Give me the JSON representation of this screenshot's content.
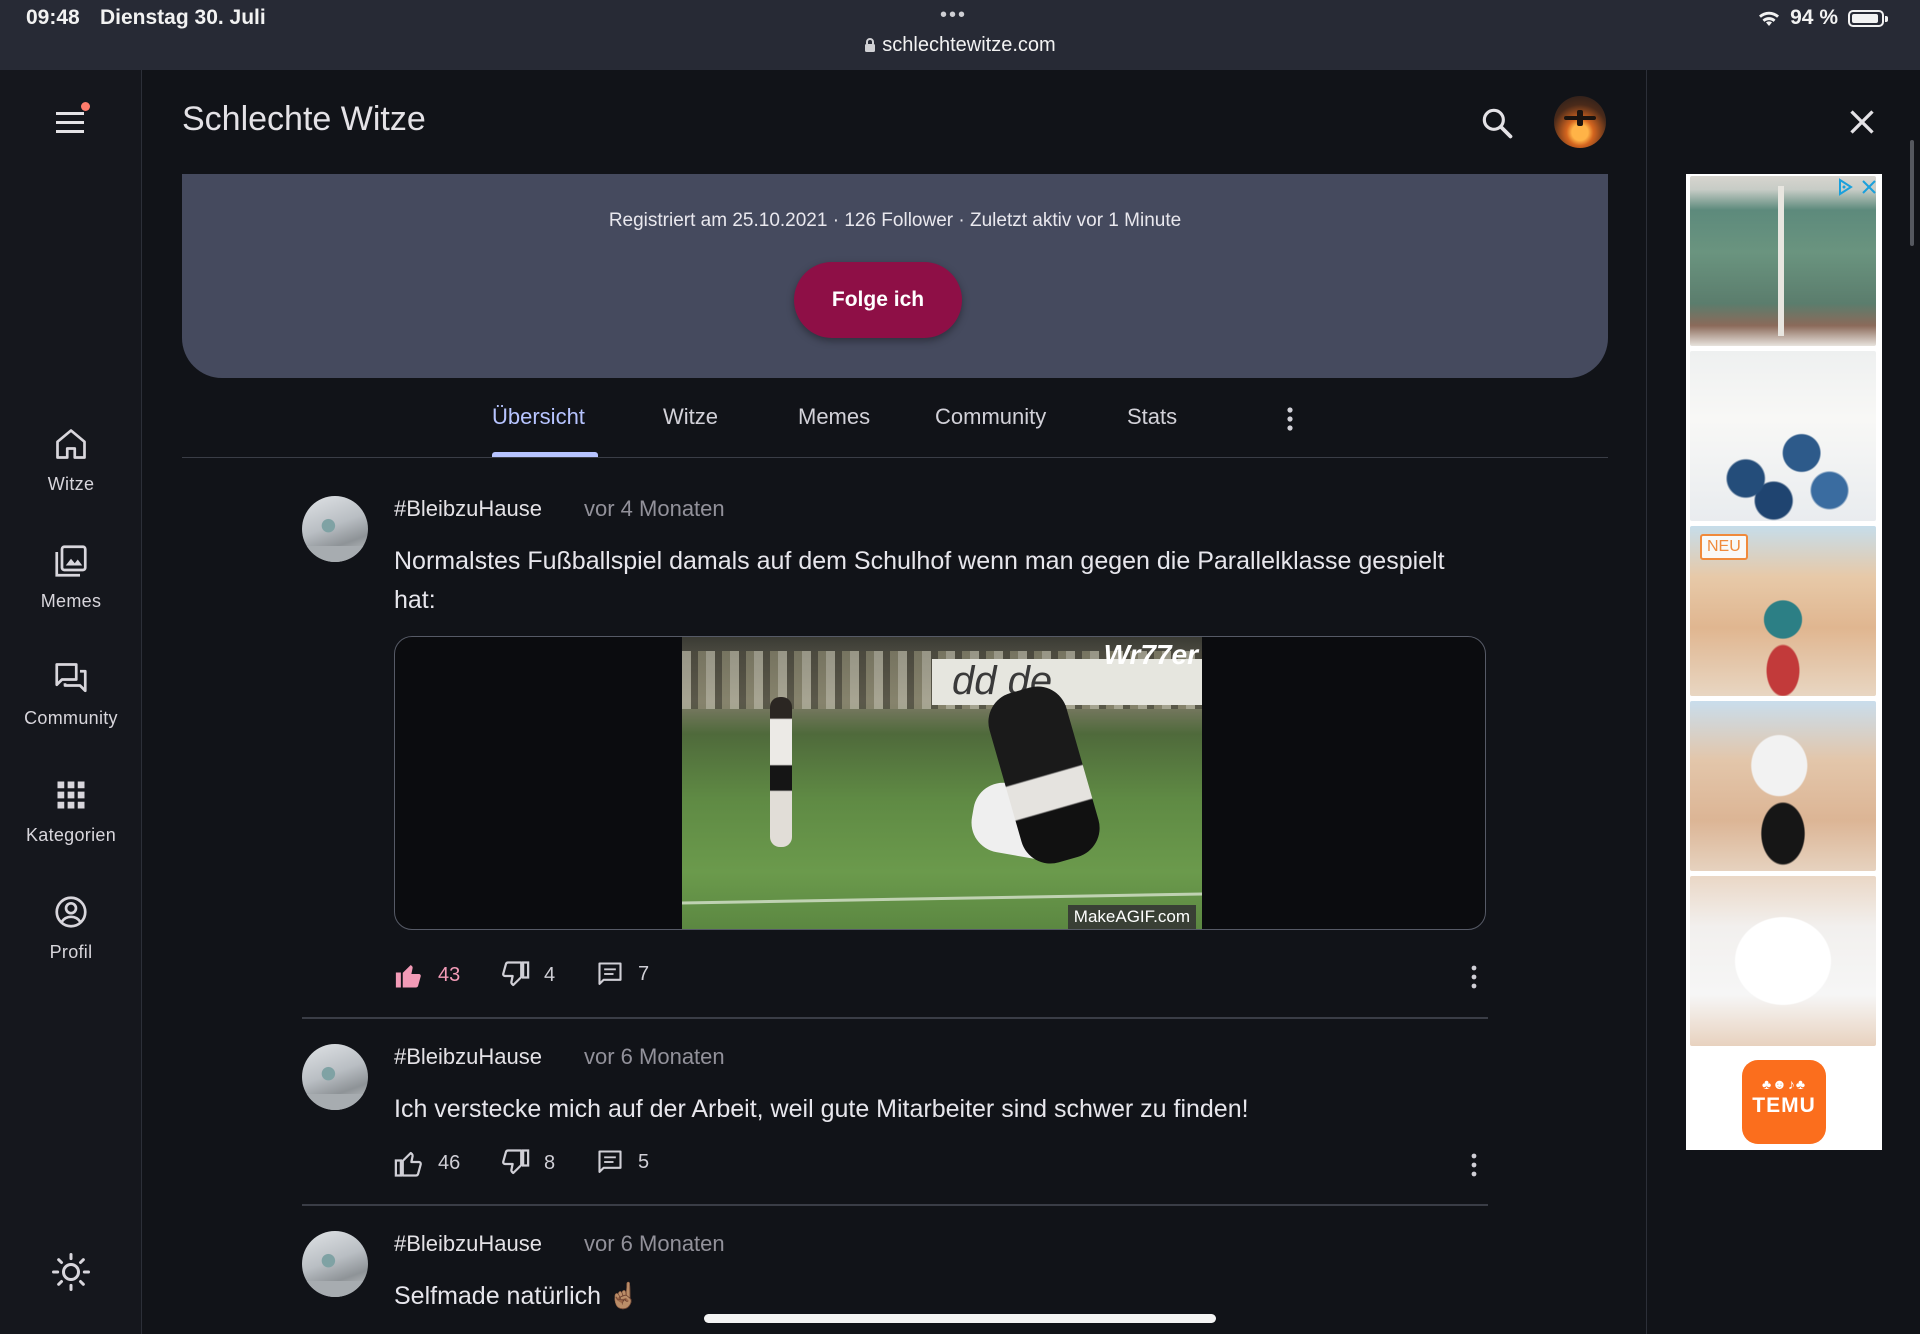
{
  "status_bar": {
    "time": "09:48",
    "date": "Dienstag 30. Juli",
    "url": "schlechtewitze.com",
    "battery": "94 %",
    "battery_level_percent": 94,
    "icons": [
      "wifi-icon",
      "battery-icon",
      "lock-icon"
    ]
  },
  "rail": {
    "items": [
      {
        "label": "Witze",
        "icon": "home-icon"
      },
      {
        "label": "Memes",
        "icon": "image-library-icon"
      },
      {
        "label": "Community",
        "icon": "forum-icon"
      },
      {
        "label": "Kategorien",
        "icon": "grid-icon"
      },
      {
        "label": "Profil",
        "icon": "account-circle-icon"
      }
    ],
    "menu_icon": "menu-icon",
    "theme_icon": "sun-icon",
    "notification_dot_color": "#ff7b6b"
  },
  "app_bar": {
    "title": "Schlechte Witze",
    "search_icon": "search-icon",
    "avatar": "user-avatar",
    "close_icon": "close-icon"
  },
  "profile": {
    "meta": "Registriert am 25.10.2021 · 126 Follower · Zuletzt aktiv vor 1 Minute",
    "follow_label": "Folge ich",
    "card_color": "#454a5e",
    "follow_color": "#8e0f46"
  },
  "tabs": {
    "items": [
      "Übersicht",
      "Witze",
      "Memes",
      "Community",
      "Stats"
    ],
    "active": "Übersicht",
    "accent_color": "#b7c4ff"
  },
  "posts": [
    {
      "author": "#BleibzuHause",
      "time": "vor 4 Monaten",
      "text": "Normalstes Fußballspiel damals auf dem Schulhof wenn man gegen die Parallelklasse gespielt hat:",
      "media": {
        "watermark_top": "Wr77er",
        "watermark_bottom": "MakeAGIF.com"
      },
      "likes": "43",
      "dislikes": "4",
      "comments": "7",
      "liked": true
    },
    {
      "author": "#BleibzuHause",
      "time": "vor 6 Monaten",
      "text": "Ich verstecke mich auf der Arbeit, weil gute Mitarbeiter sind schwer zu finden!",
      "likes": "46",
      "dislikes": "8",
      "comments": "5",
      "liked": false
    },
    {
      "author": "#BleibzuHause",
      "time": "vor 6 Monaten",
      "text": "Selfmade natürlich ☝🏽"
    }
  ],
  "ad": {
    "badge": "NEU",
    "brand": "TEMU",
    "icons": [
      "adchoices-icon",
      "ad-close-icon"
    ],
    "brand_color": "#fb6e1d"
  }
}
